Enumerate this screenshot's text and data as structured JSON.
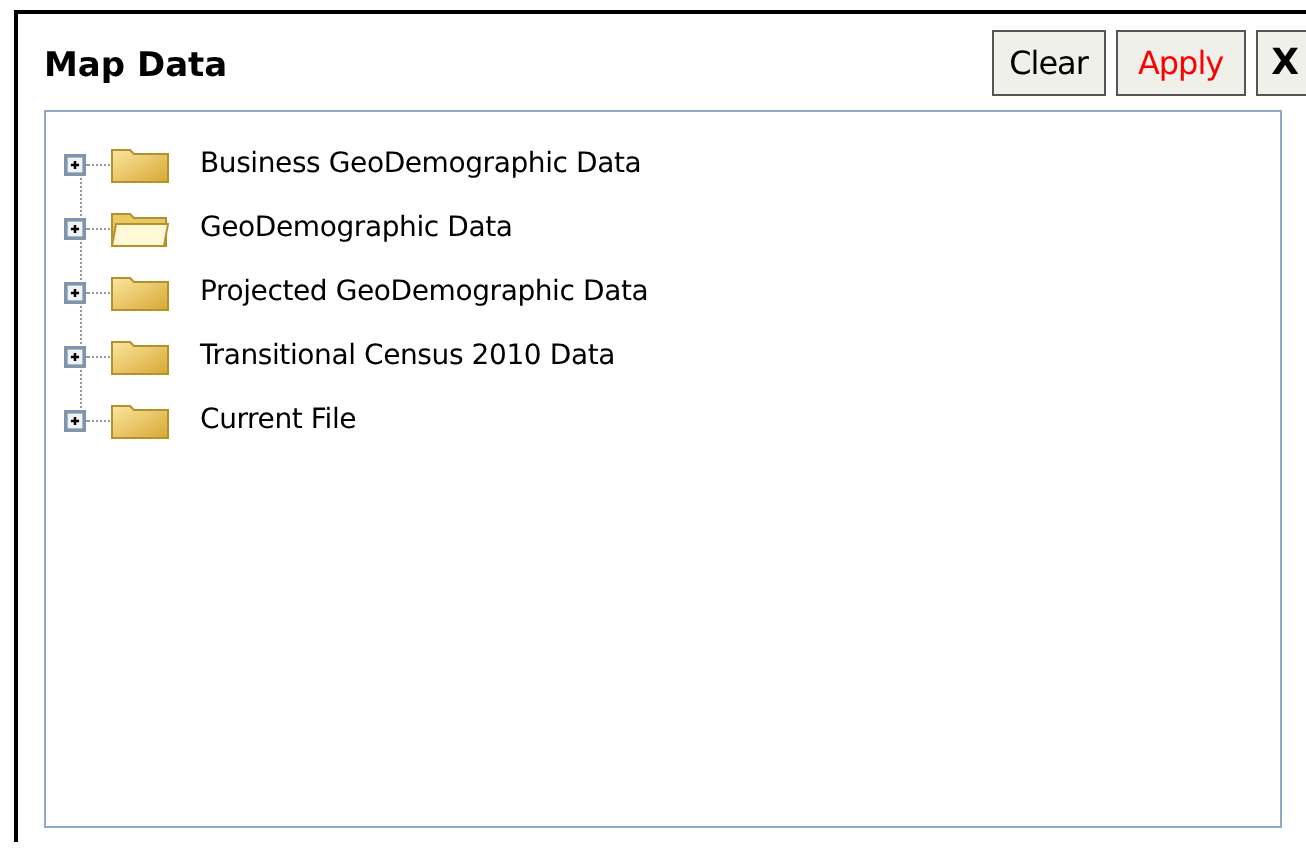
{
  "panel": {
    "title": "Map Data"
  },
  "buttons": [
    {
      "label": "Clear",
      "kind": "normal"
    },
    {
      "label": "Apply",
      "kind": "primary"
    },
    {
      "label": "X",
      "kind": "close"
    }
  ],
  "tree": {
    "items": [
      {
        "label": "Business GeoDemographic Data",
        "expanded": false,
        "kind": "closed"
      },
      {
        "label": "GeoDemographic Data",
        "expanded": false,
        "kind": "open"
      },
      {
        "label": "Projected GeoDemographic Data",
        "expanded": false,
        "kind": "closed"
      },
      {
        "label": "Transitional Census 2010 Data",
        "expanded": false,
        "kind": "closed"
      },
      {
        "label": "Current File",
        "expanded": false,
        "kind": "closed"
      }
    ]
  }
}
